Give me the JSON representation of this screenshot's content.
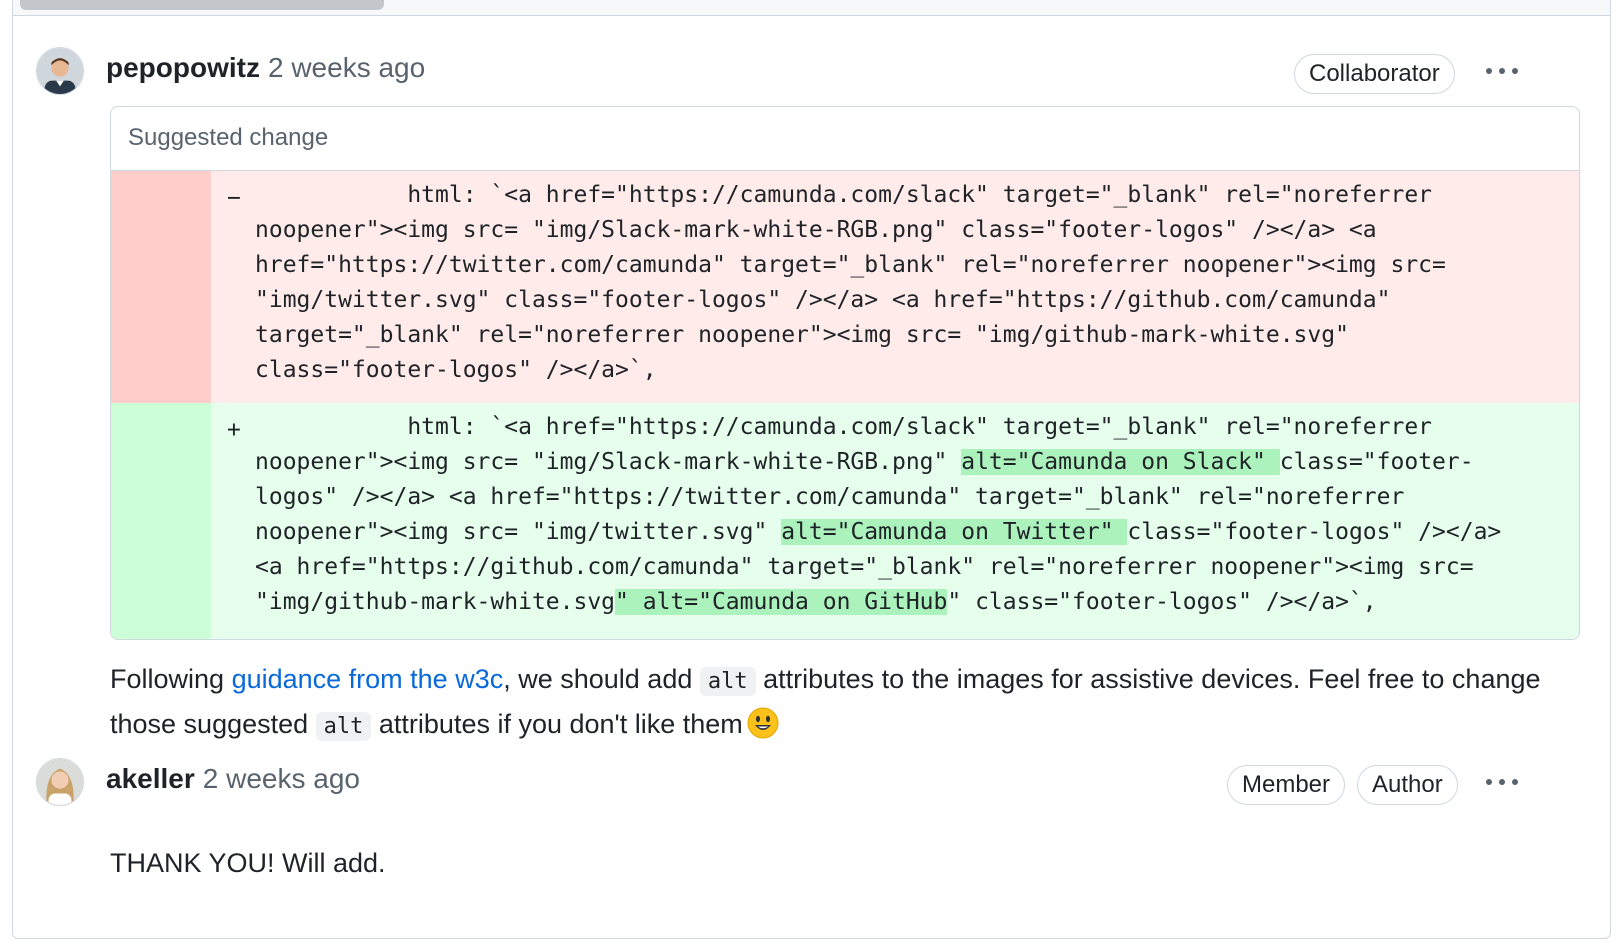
{
  "comments": [
    {
      "author": "pepopowitz",
      "time": "2 weeks ago",
      "badges": [
        "Collaborator"
      ],
      "suggestion": {
        "header": "Suggested change",
        "deleted_marker": "−",
        "added_marker": "+",
        "deleted_lines": [
          "           html: `<a href=\"https://camunda.com/slack\" target=\"_blank\" rel=\"noreferrer",
          "noopener\"><img src= \"img/Slack-mark-white-RGB.png\" class=\"footer-logos\" /></a> <a",
          "href=\"https://twitter.com/camunda\" target=\"_blank\" rel=\"noreferrer noopener\"><img src=",
          "\"img/twitter.svg\" class=\"footer-logos\" /></a> <a href=\"https://github.com/camunda\"",
          "target=\"_blank\" rel=\"noreferrer noopener\"><img src= \"img/github-mark-white.svg\"",
          "class=\"footer-logos\" /></a>`,"
        ],
        "added_lines": [
          [
            {
              "t": "           html: `<a href=\"https://camunda.com/slack\" target=\"_blank\" rel=\"noreferrer"
            }
          ],
          [
            {
              "t": "noopener\"><img src= \"img/Slack-mark-white-RGB.png\" "
            },
            {
              "t": "alt=\"Camunda on Slack\" ",
              "hl": true
            },
            {
              "t": "class=\"footer-"
            }
          ],
          [
            {
              "t": "logos\" /></a> <a href=\"https://twitter.com/camunda\" target=\"_blank\" rel=\"noreferrer"
            }
          ],
          [
            {
              "t": "noopener\"><img src= \"img/twitter.svg\" "
            },
            {
              "t": "alt=\"Camunda on Twitter\" ",
              "hl": true
            },
            {
              "t": "class=\"footer-logos\" /></a>"
            }
          ],
          [
            {
              "t": "<a href=\"https://github.com/camunda\" target=\"_blank\" rel=\"noreferrer noopener\"><img src="
            }
          ],
          [
            {
              "t": "\"img/github-mark-white.svg"
            },
            {
              "t": "\" alt=\"Camunda on GitHub",
              "hl": true
            },
            {
              "t": "\" class=\"footer-logos\" /></a>`,"
            }
          ]
        ]
      },
      "body": {
        "before_link": "Following ",
        "link": "guidance from the w3c",
        "after_link": ", we should add ",
        "code1": "alt",
        "middle": " attributes to the images for assistive devices. Feel free to change those suggested ",
        "code2": "alt",
        "end": " attributes if you don't like them"
      }
    },
    {
      "author": "akeller",
      "time": "2 weeks ago",
      "badges": [
        "Member",
        "Author"
      ],
      "body_text": "THANK YOU! Will add."
    }
  ],
  "icons": {
    "menu": "kebab-horizontal-icon",
    "emoji": "smiley-emoji"
  },
  "colors": {
    "link": "#0969da",
    "deleted_bg": "#ffebe9",
    "added_bg": "#e6ffec",
    "added_highlight": "#abf2bc"
  }
}
